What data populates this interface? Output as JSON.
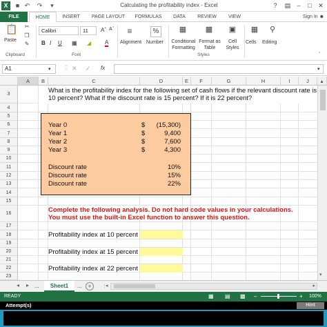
{
  "window": {
    "title": "Calculating the profitability index - Excel",
    "help": "?",
    "app_icon": "excel-icon"
  },
  "tabs": {
    "file": "FILE",
    "items": [
      "HOME",
      "INSERT",
      "PAGE LAYOUT",
      "FORMULAS",
      "DATA",
      "REVIEW",
      "VIEW"
    ],
    "signin": "Sign In"
  },
  "ribbon": {
    "paste": "Paste",
    "clipboard": "Clipboard",
    "font_name": "Calibri",
    "font_size": "11",
    "bold": "B",
    "italic": "I",
    "underline": "U",
    "font_label": "Font",
    "alignment": "Alignment",
    "number": "Number",
    "conditional_formatting": "Conditional Formatting",
    "format_as_table": "Format as Table",
    "cell_styles": "Cell Styles",
    "styles_label": "Styles",
    "cells": "Cells",
    "editing": "Editing",
    "percent": "%"
  },
  "formula_bar": {
    "name_box": "A1",
    "fx": "fx",
    "value": ""
  },
  "columns": [
    "A",
    "B",
    "C",
    "D",
    "E",
    "F",
    "G",
    "H",
    "I",
    "J"
  ],
  "rows": [
    "3",
    "4",
    "5",
    "6",
    "7",
    "8",
    "9",
    "10",
    "11",
    "12",
    "13",
    "14",
    "15",
    "16",
    "17",
    "18",
    "19",
    "20",
    "21",
    "22",
    "23"
  ],
  "sheet": {
    "question_line1": "What is the profitability index for the following set of cash flows if the relevant discount rate is",
    "question_line2": "10 percent? What if the discount rate is 15 percent? If it is 22 percent?",
    "cashflows": [
      {
        "label": "Year 0",
        "currency": "$",
        "value": "(15,300)"
      },
      {
        "label": "Year 1",
        "currency": "$",
        "value": "9,400"
      },
      {
        "label": "Year 2",
        "currency": "$",
        "value": "7,600"
      },
      {
        "label": "Year 3",
        "currency": "$",
        "value": "4,300"
      }
    ],
    "rates": [
      {
        "label": "Discount rate",
        "value": "10%"
      },
      {
        "label": "Discount rate",
        "value": "15%"
      },
      {
        "label": "Discount rate",
        "value": "22%"
      }
    ],
    "instruction_line1": "Complete the following analysis. Do not hard code values in your calculations.",
    "instruction_line2": "You must use the built-in Excel function to answer this question.",
    "answers": [
      {
        "label": "Profitability index at 10 percent",
        "value": ""
      },
      {
        "label": "Profitability index at 15 percent",
        "value": ""
      },
      {
        "label": "Profitability index at 22 percent",
        "value": ""
      }
    ]
  },
  "sheet_tabs": {
    "ellipsis_left": "...",
    "active": "Sheet1",
    "ellipsis_right": "...",
    "add": "+"
  },
  "status": {
    "ready": "READY",
    "zoom": "100%"
  },
  "attempt": {
    "label": "Attempt(s)",
    "hint": "Hint"
  },
  "colors": {
    "excel_green": "#217346",
    "orange_fill": "#fccb9f",
    "yellow_fill": "#fffb9b",
    "red_text": "#e11414"
  }
}
